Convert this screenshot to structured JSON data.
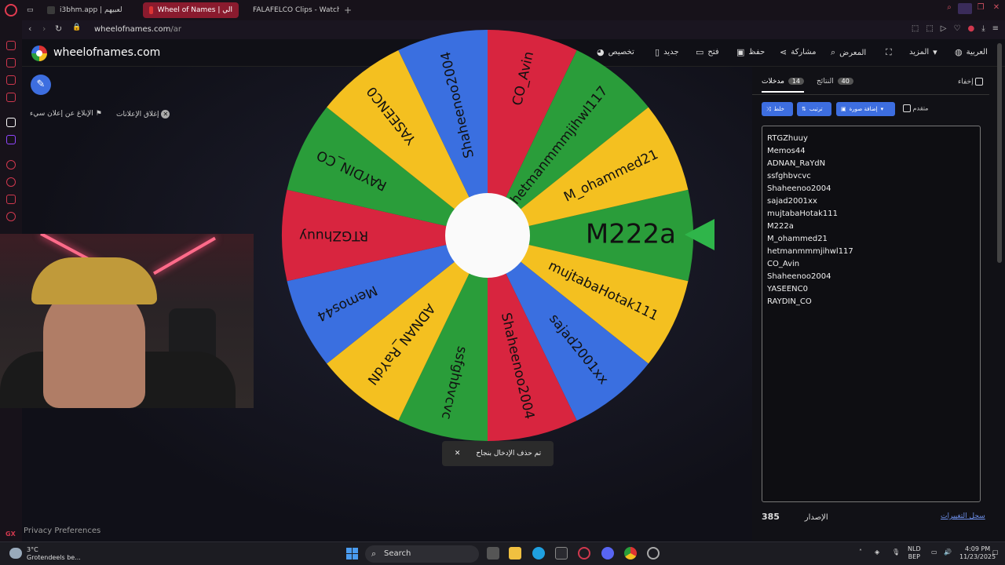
{
  "browser": {
    "tabs": [
      {
        "label": "i3bhm.app | لعبيهم",
        "active": false,
        "color": "#3a3a3a"
      },
      {
        "label": "Wheel of Names | الي",
        "active": true,
        "color": "#d33"
      },
      {
        "label": "FALAFELCO Clips - Watch",
        "active": false,
        "color": "#53fc18"
      }
    ],
    "url_main": "wheelofnames.com",
    "url_path": "/ar"
  },
  "app": {
    "site_name": "wheelofnames.com",
    "menu": {
      "customize": "تخصيص",
      "new": "جديد",
      "open": "فتح",
      "save": "حفظ",
      "share": "مشاركة",
      "gallery": "المعرض",
      "more": "المزيد",
      "language": "العربية"
    },
    "ad_report": "الإبلاغ عن إعلان سيء",
    "ad_close": "إغلاق الإعلانات",
    "privacy": "Privacy Preferences",
    "toast": "تم حذف الإدخال بنجاح",
    "toast_close": "✕"
  },
  "wheel": {
    "colors": [
      "#3a6fe0",
      "#d8253f",
      "#f4c020",
      "#2a9d3a"
    ],
    "pointer_color": "#2fb54a",
    "winner": "M222a",
    "segments": [
      "M222a",
      "mujtabaHotak111",
      "sajad2001xx",
      "Shaheenoo2004",
      "ssfghbvcvc",
      "ADNAN_RaYdN",
      "Memos44",
      "RTGZhuuy",
      "RAYDIN_CO",
      "YASEENC0",
      "Shaheenoo2004",
      "CO_Avin",
      "hetmanmmmjihwl117",
      "M_ohammed21"
    ]
  },
  "panel": {
    "hide_label": "إخفاء",
    "tab_entries": "مدخلات",
    "tab_entries_count": "14",
    "tab_results": "النتائج",
    "tab_results_count": "40",
    "shuffle": "خلط",
    "sort": "ترتيب",
    "add_image": "إضافة صورة",
    "advanced": "متقدم",
    "entries": [
      "RTGZhuuy",
      "Memos44",
      "ADNAN_RaYdN",
      "ssfghbvcvc",
      "Shaheenoo2004",
      "sajad2001xx",
      "mujtabaHotak111",
      "M222a",
      "M_ohammed21",
      "hetmanmmmjihwl117",
      "CO_Avin",
      "Shaheenoo2004",
      "YASEENC0",
      "RAYDIN_CO"
    ],
    "version_number": "385",
    "version_label": "الإصدار",
    "changelog": "سجل التغييرات"
  },
  "taskbar": {
    "temp": "3°C",
    "weather": "Grotendeels be...",
    "search": "Search",
    "lang": "NLD",
    "lang2": "BEP",
    "time": "4:09 PM",
    "date": "11/23/2025"
  }
}
